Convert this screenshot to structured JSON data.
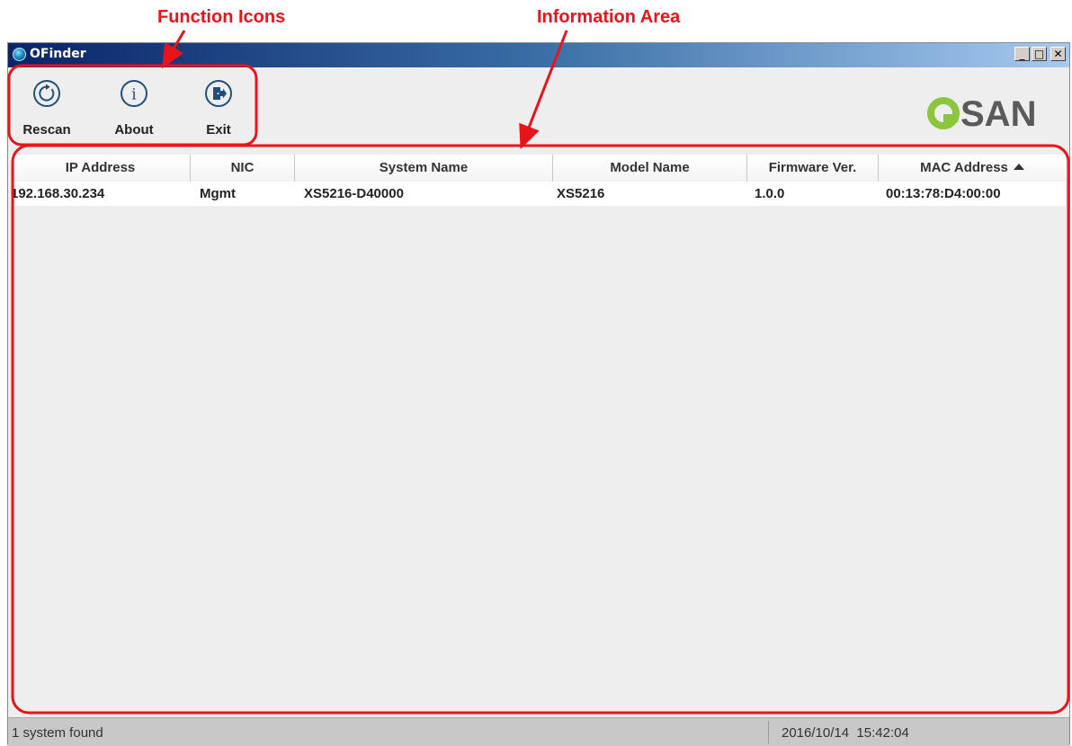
{
  "annotations": {
    "function_icons_label": "Function Icons",
    "information_area_label": "Information Area",
    "highlight_color": "#e8141b"
  },
  "window": {
    "title": "OFinder",
    "controls": {
      "minimize": "_",
      "maximize": "□",
      "close": "✕"
    }
  },
  "toolbar": {
    "buttons": [
      {
        "label": "Rescan",
        "icon": "refresh-icon"
      },
      {
        "label": "About",
        "icon": "info-icon"
      },
      {
        "label": "Exit",
        "icon": "exit-icon"
      }
    ],
    "logo": "QSAN",
    "logo_color": "#8cc63f",
    "logo_text_color": "#5a5a5a"
  },
  "table": {
    "columns": [
      "IP Address",
      "NIC",
      "System Name",
      "Model Name",
      "Firmware Ver.",
      "MAC Address"
    ],
    "sorted_column": "MAC Address",
    "sort_direction": "ascending",
    "rows": [
      [
        "192.168.30.234",
        "Mgmt",
        "XS5216-D40000",
        "XS5216",
        "1.0.0",
        "00:13:78:D4:00:00"
      ]
    ]
  },
  "status": {
    "left": "1 system found",
    "right": "2016/10/14  15:42:04"
  }
}
